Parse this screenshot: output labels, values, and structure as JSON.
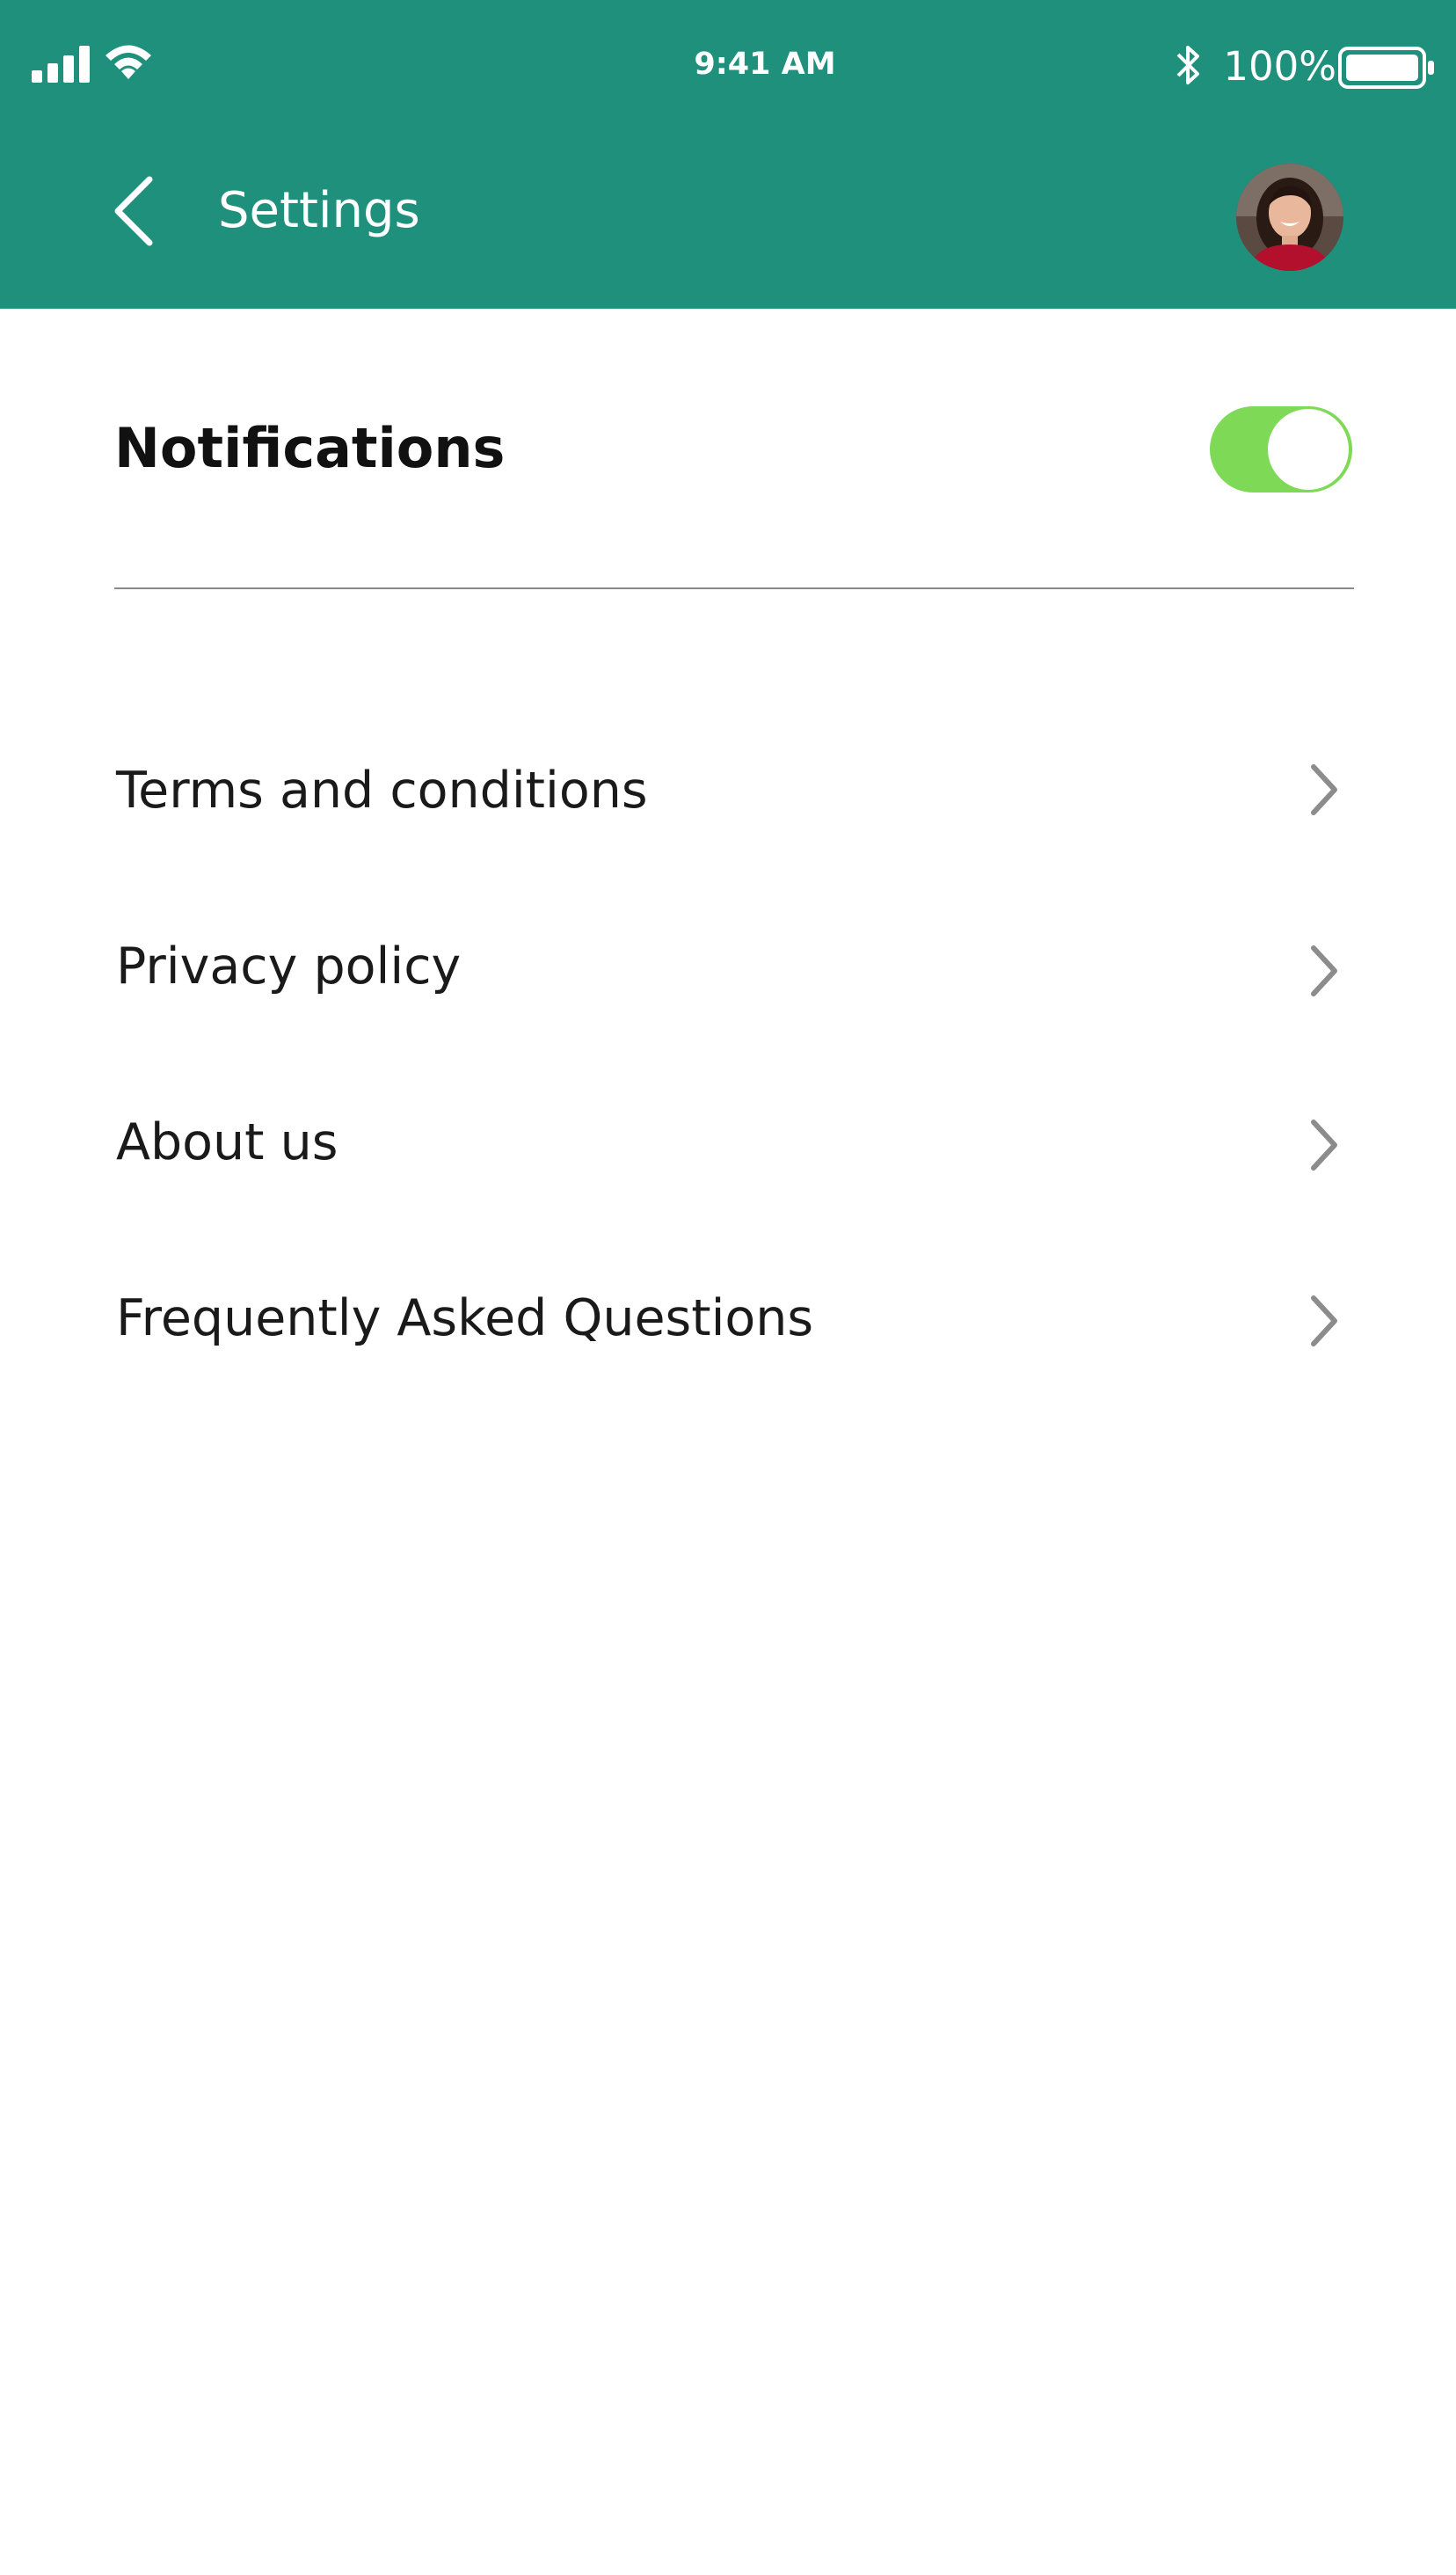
{
  "status_bar": {
    "time": "9:41 AM",
    "battery_percent": "100%",
    "icons": [
      "signal-icon",
      "wifi-icon",
      "bluetooth-icon",
      "battery-icon"
    ]
  },
  "nav": {
    "title": "Settings",
    "back_icon": "chevron-left-icon",
    "avatar_icon": "user-avatar"
  },
  "notifications": {
    "label": "Notifications",
    "enabled": true
  },
  "menu": {
    "items": [
      {
        "label": "Terms and conditions"
      },
      {
        "label": "Privacy policy"
      },
      {
        "label": "About us"
      },
      {
        "label": "Frequently Asked Questions"
      }
    ]
  },
  "colors": {
    "header_bg": "#1f907b",
    "toggle_on": "#7ed957",
    "divider": "#8a8a8a",
    "chevron": "#8c8c8c"
  }
}
